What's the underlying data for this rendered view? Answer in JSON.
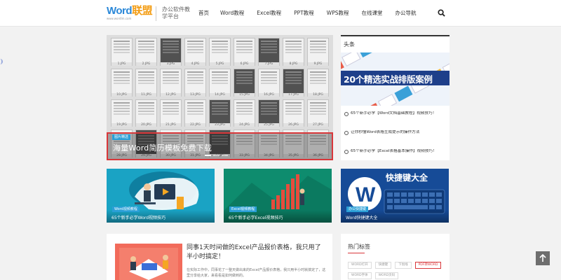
{
  "header": {
    "logo": {
      "word": "Word",
      "lian": "联盟",
      "url": "www.wordlm.com"
    },
    "slogan": "办公软件教学平台",
    "nav": [
      "首页",
      "Word教程",
      "Excel教程",
      "PPT教程",
      "WPS教程",
      "在线课堂",
      "办公导航"
    ]
  },
  "slider": {
    "thumb_labels": [
      "1.JPG",
      "2.JPG",
      "3.JPG",
      "4.JPG",
      "5.JPG",
      "6.JPG",
      "7.JPG",
      "8.JPG",
      "9.JPG",
      "10.JPG",
      "11.JPG",
      "12.JPG",
      "13.JPG",
      "14.JPG",
      "15.JPG",
      "16.JPG",
      "17.JPG",
      "18.JPG",
      "19.JPG",
      "20.JPG",
      "21.JPG",
      "22.JPG",
      "23.JPG",
      "24.JPG",
      "25.JPG",
      "26.JPG",
      "27.JPG",
      "28.JPG",
      "29.JPG",
      "30.JPG",
      "31.JPG",
      "32.JPG",
      "33.JPG",
      "34.JPG",
      "35.JPG",
      "36.JPG"
    ],
    "tag": "图片精选",
    "title": "海量Word简历模板免费下载"
  },
  "headlines": {
    "title": "头条",
    "banner_text": "20个精选实战排版案例",
    "items": [
      "65个新手必学【Word文档基础教程】视频技巧！",
      "让你秒懂Word表格生成提示的操作方法",
      "65个新手必学【Excel表格基本操作】视频技巧！"
    ]
  },
  "cards": [
    {
      "tag": "Word视频教程",
      "title": "65个新手必学Word视频技巧",
      "color": "#1aa3c4"
    },
    {
      "tag": "Excel视频教程",
      "title": "65个新手必学Excel视频技巧",
      "color": "#0e8c6e"
    },
    {
      "tag": "办公快捷键",
      "title": "Word快捷键大全",
      "banner": "快捷键大全",
      "color": "#164b97"
    }
  ],
  "article": {
    "title": "同事1天时间做的Excel产品报价表格，我只用了半小时搞定！",
    "excerpt": "在实际工作中，同事花了一整天做出来的Excel产品报价表格，我只用半小时就搞定了，这里分享给大家，来看看是如何做到的。"
  },
  "hot_tags": {
    "title": "热门标签",
    "tags": [
      {
        "label": "WORD打开",
        "red": false
      },
      {
        "label": "快捷键",
        "red": false
      },
      {
        "label": "下划线",
        "red": false
      },
      {
        "label": "PDF转WORD",
        "red": true
      },
      {
        "label": "WORD字体",
        "red": false
      },
      {
        "label": "WORD页码",
        "red": false
      }
    ]
  }
}
